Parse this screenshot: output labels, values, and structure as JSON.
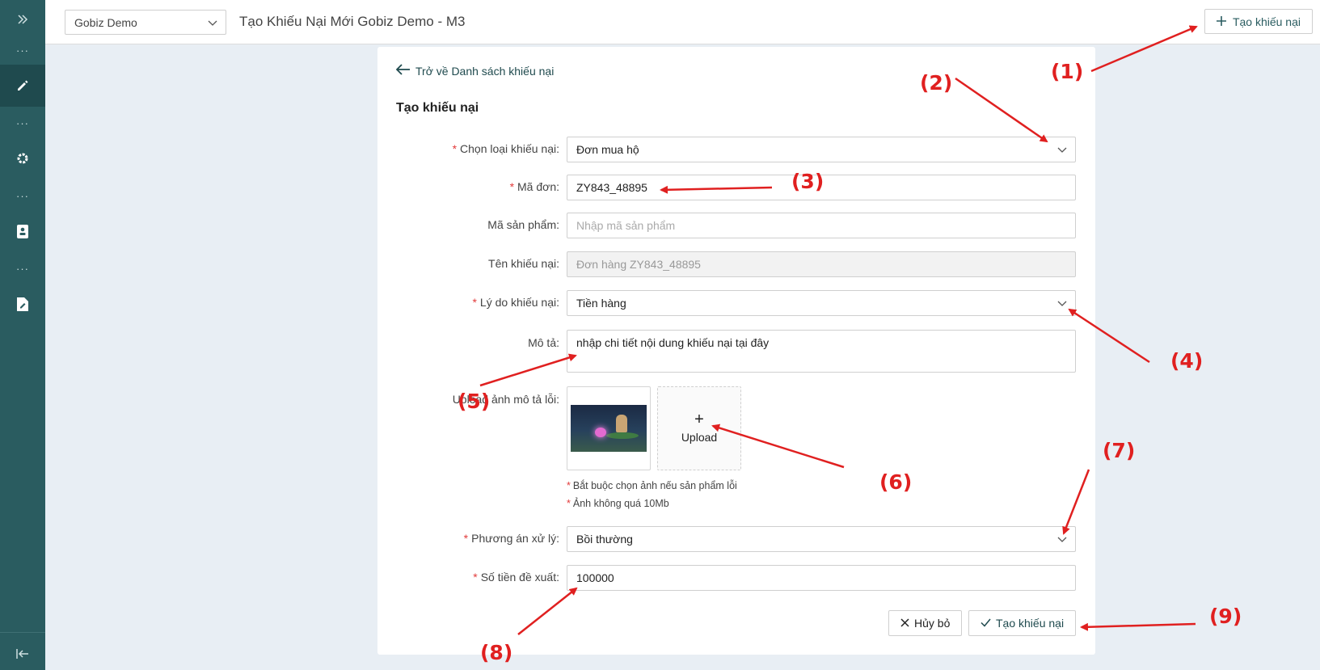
{
  "topbar": {
    "tenant": "Gobiz Demo",
    "title": "Tạo Khiếu Nại Mới Gobiz Demo - M3",
    "create_button": "Tạo khiếu nại"
  },
  "sidebar": {
    "items": [
      "expand",
      "pencil",
      "gear",
      "contact-card",
      "document"
    ],
    "dots": "···"
  },
  "form": {
    "back_link": "Trở về Danh sách khiếu nại",
    "heading": "Tạo khiếu nại",
    "type": {
      "label": "Chọn loại khiếu nại",
      "value": "Đơn mua hộ"
    },
    "order_code": {
      "label": "Mã đơn",
      "value": "ZY843_48895"
    },
    "product_code": {
      "label": "Mã sản phẩm",
      "placeholder": "Nhập mã sản phẩm"
    },
    "complaint_name": {
      "label": "Tên khiếu nại",
      "value": "Đơn hàng ZY843_48895"
    },
    "reason": {
      "label": "Lý do khiếu nại",
      "value": "Tiền hàng"
    },
    "description": {
      "label": "Mô tả",
      "value": "nhập chi tiết nội dung khiếu nại tại đây"
    },
    "upload": {
      "label": "Upload ảnh mô tả lỗi",
      "button": "Upload",
      "note1": "Bắt buộc chọn ảnh nếu sản phẩm lỗi",
      "note2": "Ảnh không quá 10Mb"
    },
    "resolution": {
      "label": "Phương án xử lý",
      "value": "Bồi thường"
    },
    "amount": {
      "label": "Số tiền đề xuất",
      "value": "100000"
    },
    "cancel_button": "Hủy bỏ",
    "submit_button": "Tạo khiếu nại"
  },
  "annotations": [
    "(1)",
    "(2)",
    "(3)",
    "(4)",
    "(5)",
    "(6)",
    "(7)",
    "(8)",
    "(9)"
  ],
  "colors": {
    "sidebar": "#2a5c60",
    "accent": "#1f4a4e",
    "annotation": "#e02020",
    "required": "#e23b3b"
  }
}
